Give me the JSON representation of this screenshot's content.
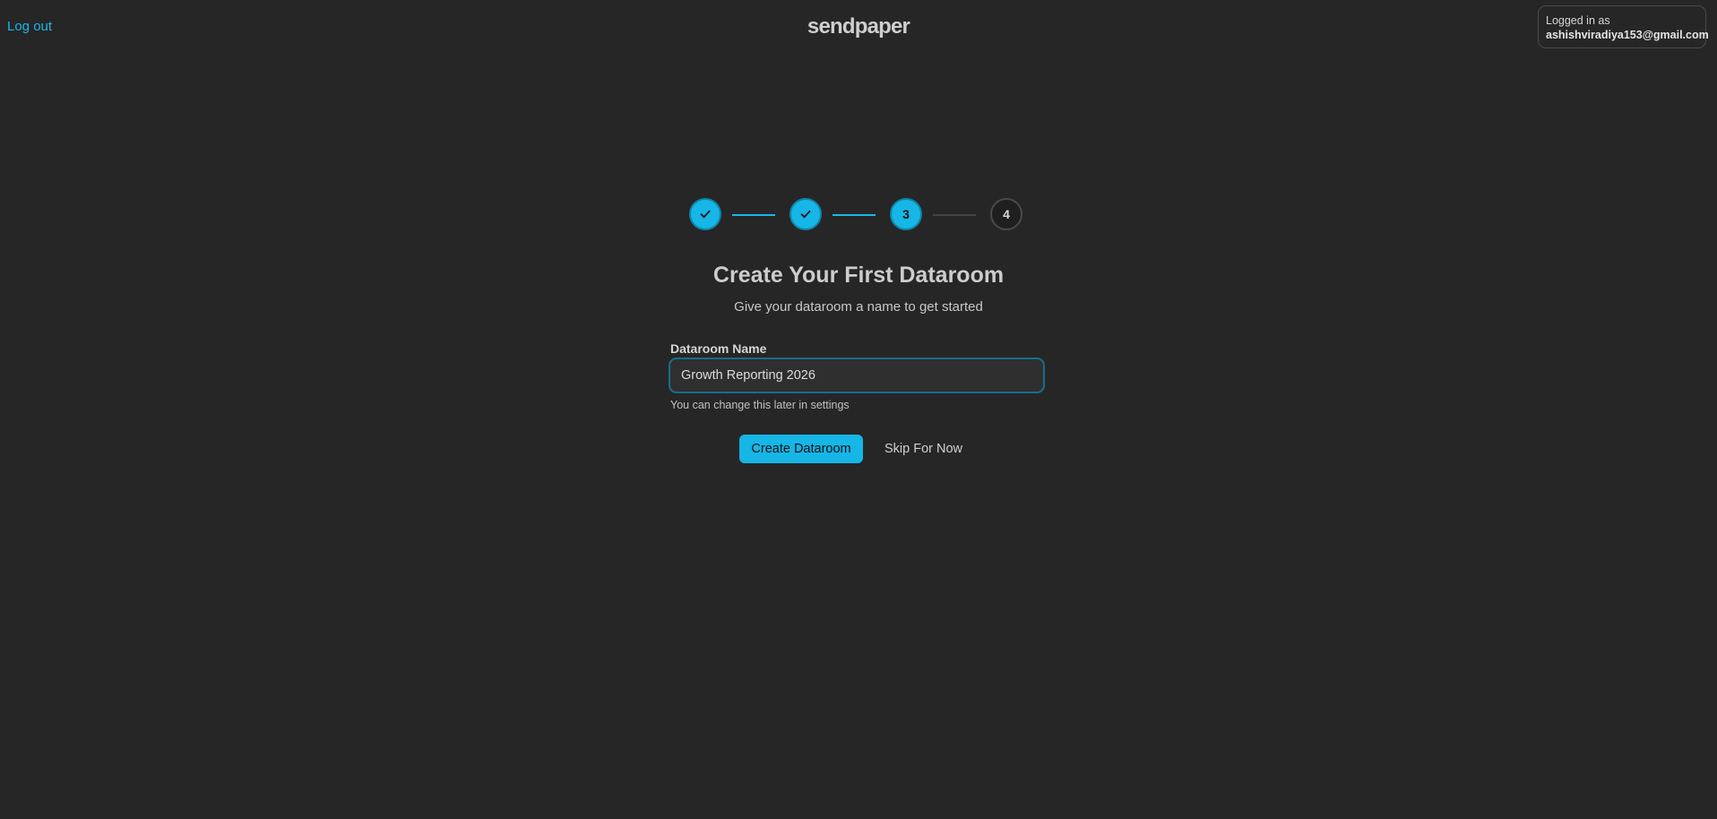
{
  "header": {
    "logout_label": "Log out",
    "brand": "sendpaper",
    "account": {
      "label": "Logged in as",
      "email": "ashishviradiya153@gmail.com"
    }
  },
  "stepper": {
    "steps": [
      {
        "state": "done",
        "icon": "check-icon"
      },
      {
        "state": "done",
        "icon": "check-icon"
      },
      {
        "state": "current",
        "number": "3"
      },
      {
        "state": "todo",
        "number": "4"
      }
    ]
  },
  "main": {
    "title": "Create Your First Dataroom",
    "subtitle": "Give your dataroom a name to get started",
    "field_label": "Dataroom Name",
    "field_value": "Growth Reporting 2026",
    "hint": "You can change this later in settings",
    "primary_button": "Create Dataroom",
    "secondary_button": "Skip For Now"
  },
  "colors": {
    "accent": "#16b6e6",
    "background": "#262626"
  }
}
